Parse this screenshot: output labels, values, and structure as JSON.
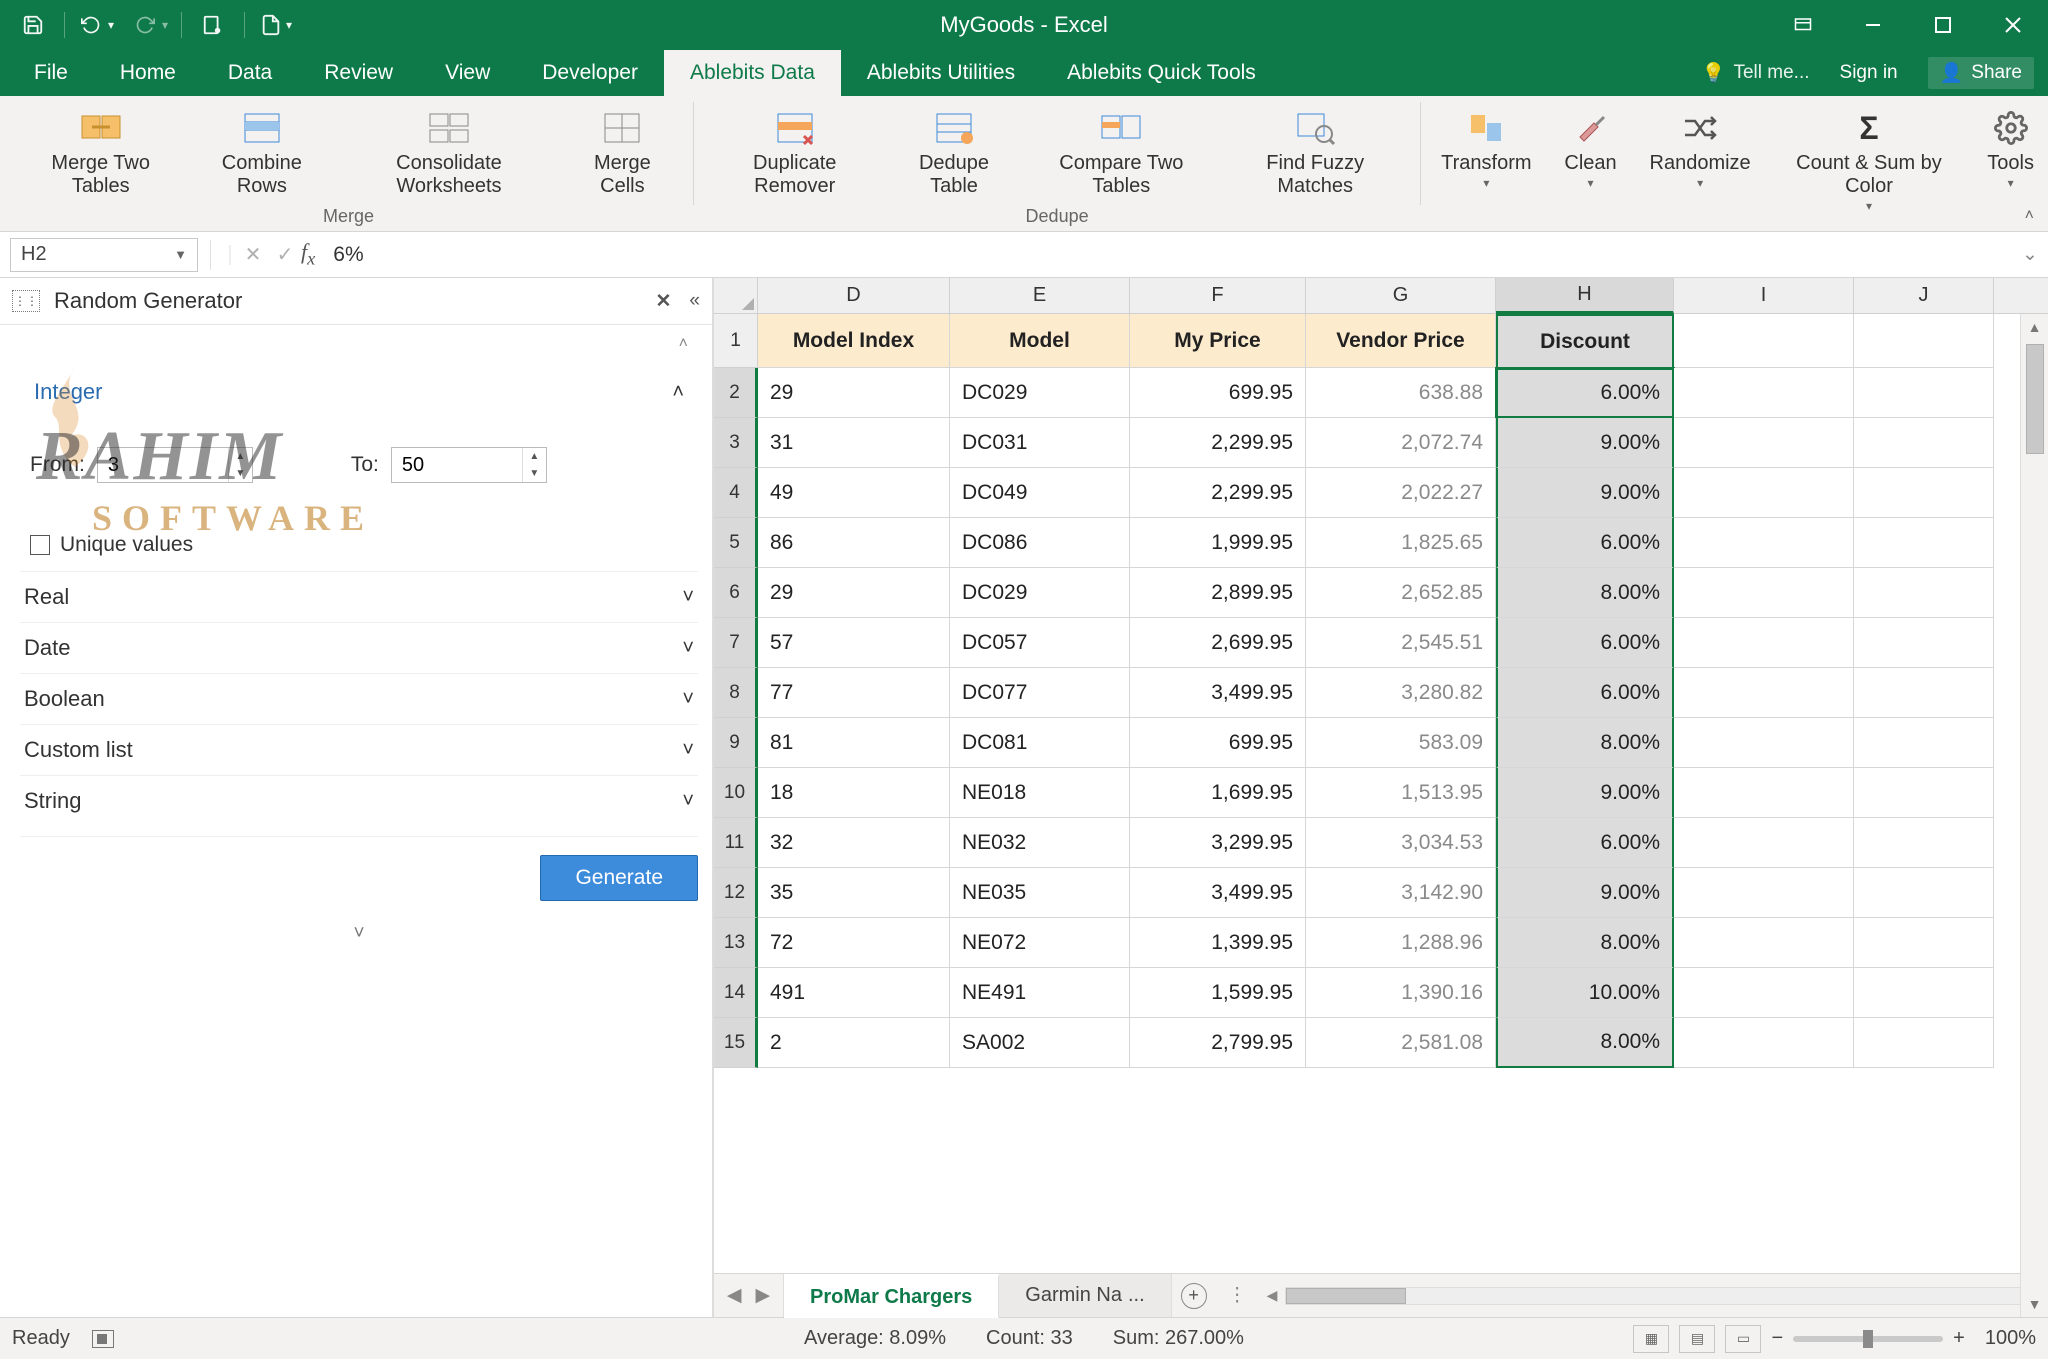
{
  "title": "MyGoods - Excel",
  "tabs": [
    "File",
    "Home",
    "Data",
    "Review",
    "View",
    "Developer",
    "Ablebits Data",
    "Ablebits Utilities",
    "Ablebits Quick Tools"
  ],
  "active_tab": 6,
  "tellme": "Tell me...",
  "signin": "Sign in",
  "share": "Share",
  "ribbon_groups": {
    "merge": {
      "name": "Merge",
      "buttons": [
        "Merge Two Tables",
        "Combine Rows",
        "Consolidate Worksheets",
        "Merge Cells"
      ]
    },
    "dedupe": {
      "name": "Dedupe",
      "buttons": [
        "Duplicate Remover",
        "Dedupe Table",
        "Compare Two Tables",
        "Find Fuzzy Matches"
      ]
    },
    "other": [
      {
        "label": "Transform",
        "drop": true
      },
      {
        "label": "Clean",
        "drop": true
      },
      {
        "label": "Randomize",
        "drop": true
      },
      {
        "label": "Count & Sum by Color",
        "drop": true
      },
      {
        "label": "Tools",
        "drop": true
      }
    ]
  },
  "namebox": "H2",
  "formula": "6%",
  "panel": {
    "title": "Random Generator",
    "sections": [
      "Integer",
      "Real",
      "Date",
      "Boolean",
      "Custom list",
      "String"
    ],
    "from_label": "From:",
    "to_label": "To:",
    "from_val": "3",
    "to_val": "50",
    "unique": "Unique values",
    "generate": "Generate"
  },
  "watermark": {
    "line1": "RAHIM",
    "line2": "SOFTWARE"
  },
  "columns": [
    "D",
    "E",
    "F",
    "G",
    "H",
    "I",
    "J"
  ],
  "selected_col": "H",
  "headers": [
    "Model Index",
    "Model",
    "My Price",
    "Vendor Price",
    "Discount"
  ],
  "rows": [
    {
      "n": 2,
      "d": "29",
      "e": "DC029",
      "f": "699.95",
      "g": "638.88",
      "h": "6.00%"
    },
    {
      "n": 3,
      "d": "31",
      "e": "DC031",
      "f": "2,299.95",
      "g": "2,072.74",
      "h": "9.00%"
    },
    {
      "n": 4,
      "d": "49",
      "e": "DC049",
      "f": "2,299.95",
      "g": "2,022.27",
      "h": "9.00%"
    },
    {
      "n": 5,
      "d": "86",
      "e": "DC086",
      "f": "1,999.95",
      "g": "1,825.65",
      "h": "6.00%"
    },
    {
      "n": 6,
      "d": "29",
      "e": "DC029",
      "f": "2,899.95",
      "g": "2,652.85",
      "h": "8.00%"
    },
    {
      "n": 7,
      "d": "57",
      "e": "DC057",
      "f": "2,699.95",
      "g": "2,545.51",
      "h": "6.00%"
    },
    {
      "n": 8,
      "d": "77",
      "e": "DC077",
      "f": "3,499.95",
      "g": "3,280.82",
      "h": "6.00%"
    },
    {
      "n": 9,
      "d": "81",
      "e": "DC081",
      "f": "699.95",
      "g": "583.09",
      "h": "8.00%"
    },
    {
      "n": 10,
      "d": "18",
      "e": "NE018",
      "f": "1,699.95",
      "g": "1,513.95",
      "h": "9.00%"
    },
    {
      "n": 11,
      "d": "32",
      "e": "NE032",
      "f": "3,299.95",
      "g": "3,034.53",
      "h": "6.00%"
    },
    {
      "n": 12,
      "d": "35",
      "e": "NE035",
      "f": "3,499.95",
      "g": "3,142.90",
      "h": "9.00%"
    },
    {
      "n": 13,
      "d": "72",
      "e": "NE072",
      "f": "1,399.95",
      "g": "1,288.96",
      "h": "8.00%"
    },
    {
      "n": 14,
      "d": "491",
      "e": "NE491",
      "f": "1,599.95",
      "g": "1,390.16",
      "h": "10.00%"
    },
    {
      "n": 15,
      "d": "2",
      "e": "SA002",
      "f": "2,799.95",
      "g": "2,581.08",
      "h": "8.00%"
    }
  ],
  "sheet_tabs": {
    "active": "ProMar Chargers",
    "next": "Garmin Na",
    "ellipsis": "..."
  },
  "status": {
    "ready": "Ready",
    "avg": "Average: 8.09%",
    "count": "Count: 33",
    "sum": "Sum: 267.00%",
    "zoom": "100%"
  }
}
